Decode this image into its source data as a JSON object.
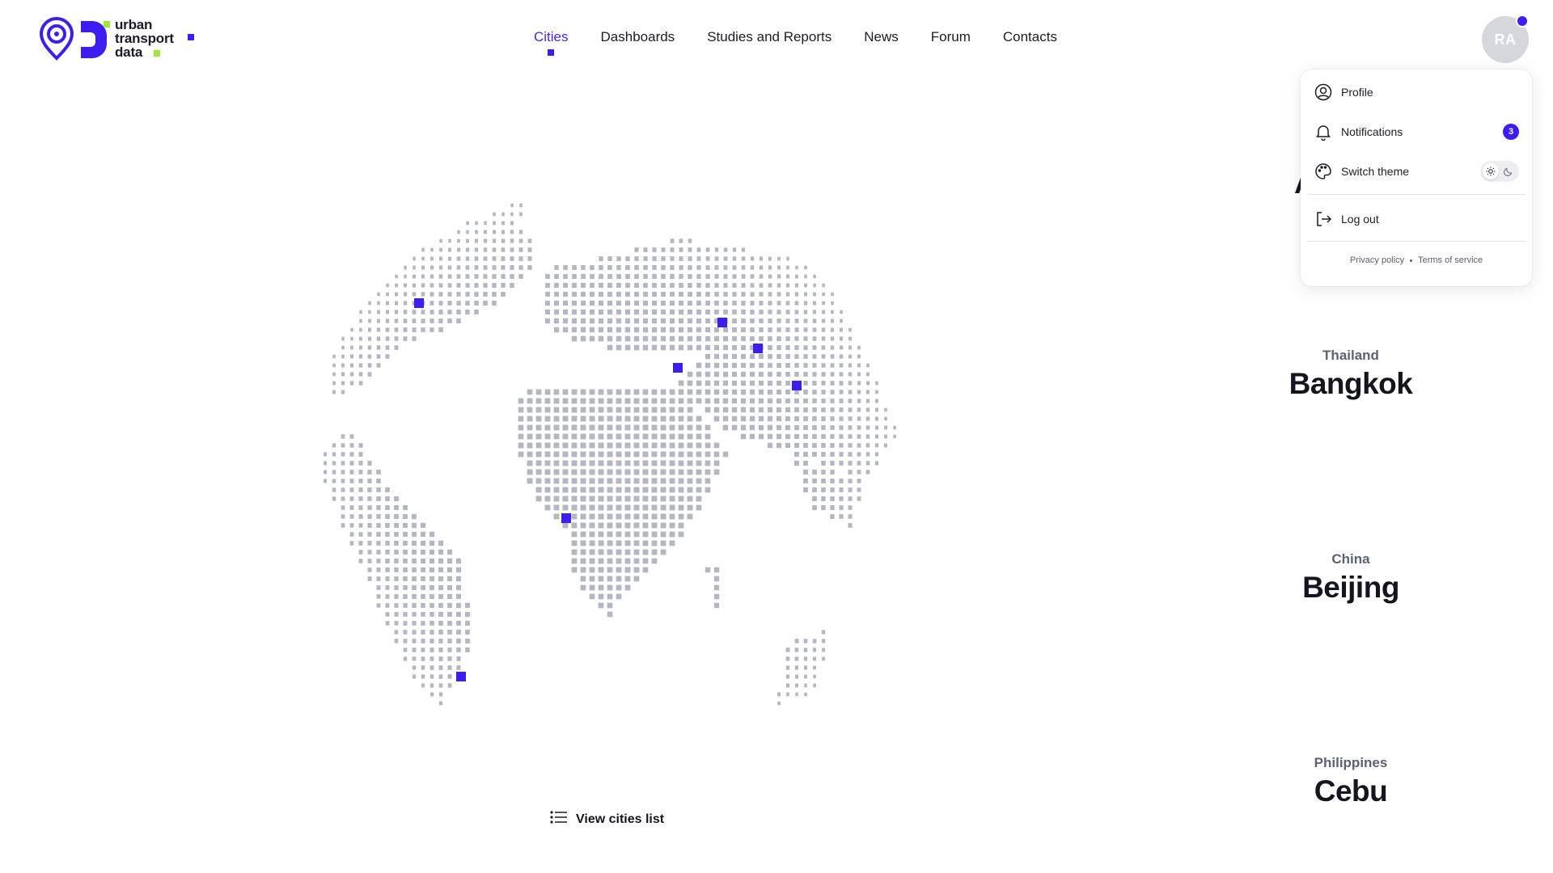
{
  "brand": {
    "name_lines": [
      "urban",
      "transport",
      "data"
    ],
    "accent_color": "#3d1ef0",
    "secondary_color": "#9fe83a"
  },
  "nav": {
    "items": [
      {
        "label": "Cities",
        "active": true
      },
      {
        "label": "Dashboards",
        "active": false
      },
      {
        "label": "Studies and Reports",
        "active": false
      },
      {
        "label": "News",
        "active": false
      },
      {
        "label": "Forum",
        "active": false
      },
      {
        "label": "Contacts",
        "active": false
      }
    ]
  },
  "user": {
    "initials": "RA",
    "has_unread": true
  },
  "user_menu": {
    "profile_label": "Profile",
    "notifications_label": "Notifications",
    "notifications_count": "3",
    "switch_theme_label": "Switch theme",
    "theme_current": "light",
    "logout_label": "Log out",
    "privacy_label": "Privacy policy",
    "terms_label": "Terms of service"
  },
  "cities": {
    "partially_hidden_letter": "A",
    "items": [
      {
        "country": "Thailand",
        "name": "Bangkok"
      },
      {
        "country": "China",
        "name": "Beijing"
      },
      {
        "country": "Philippines",
        "name": "Cebu"
      }
    ]
  },
  "globe": {
    "dot_color": "#b3b7c1",
    "marker_color": "#3d1ef0",
    "marker_count": 8
  },
  "view_list": {
    "label": "View cities list"
  }
}
